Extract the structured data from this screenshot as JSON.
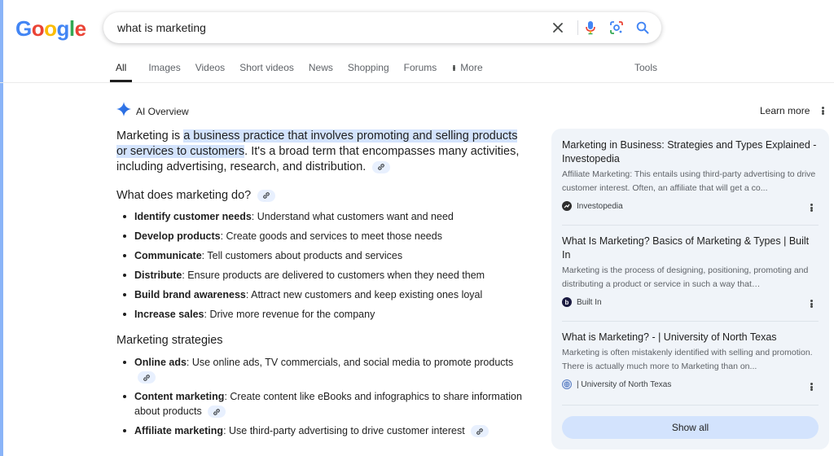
{
  "logo": {
    "letters": [
      "G",
      "o",
      "o",
      "g",
      "l",
      "e"
    ]
  },
  "search": {
    "query": "what is marketing"
  },
  "tabs": [
    {
      "label": "All",
      "active": true
    },
    {
      "label": "Images"
    },
    {
      "label": "Videos"
    },
    {
      "label": "Short videos"
    },
    {
      "label": "News"
    },
    {
      "label": "Shopping"
    },
    {
      "label": "Forums"
    },
    {
      "label": "More"
    }
  ],
  "tools_label": "Tools",
  "ai_overview": {
    "title": "AI Overview",
    "learn_more": "Learn more",
    "summary_prefix": "Marketing is ",
    "summary_highlight_1": "a business practice that involves promoting and selling products",
    "summary_highlight_2": "or services to customers",
    "summary_rest": ". It's a broad term that encompasses many activities, including advertising, research, and distribution.",
    "section1_heading": "What does marketing do?",
    "section1_items": [
      {
        "term": "Identify customer needs",
        "desc": ": Understand what customers want and need"
      },
      {
        "term": "Develop products",
        "desc": ": Create goods and services to meet those needs"
      },
      {
        "term": "Communicate",
        "desc": ": Tell customers about products and services"
      },
      {
        "term": "Distribute",
        "desc": ": Ensure products are delivered to customers when they need them"
      },
      {
        "term": "Build brand awareness",
        "desc": ": Attract new customers and keep existing ones loyal"
      },
      {
        "term": "Increase sales",
        "desc": ": Drive more revenue for the company"
      }
    ],
    "section2_heading": "Marketing strategies",
    "section2_items": [
      {
        "term": "Online ads",
        "desc": ": Use online ads, TV commercials, and social media to promote products"
      },
      {
        "term": "Content marketing",
        "desc": ": Create content like eBooks and infographics to share information about products"
      },
      {
        "term": "Affiliate marketing",
        "desc": ": Use third-party advertising to drive customer interest"
      }
    ]
  },
  "sources": [
    {
      "title": "Marketing in Business: Strategies and Types Explained - Investopedia",
      "snippet": "Affiliate Marketing: This entails using third-party advertising to drive customer interest. Often, an affiliate that will get a co...",
      "site": "Investopedia",
      "favicon_color": "#2d2d2d"
    },
    {
      "title": "What Is Marketing? Basics of Marketing & Types | Built In",
      "snippet": "Marketing is the process of designing, positioning, promoting and distributing a product or service in such a way that…",
      "site": "Built In",
      "favicon_color": "#1a1a40"
    },
    {
      "title": "What is Marketing? - | University of North Texas",
      "snippet": "Marketing is often mistakenly identified with selling and promotion. There is actually much more to Marketing than on...",
      "site": "| University of North Texas",
      "favicon_color": "#5b7fc4"
    }
  ],
  "show_all_label": "Show all",
  "colors": {
    "accent_blue": "#1a73e8",
    "chip_bg": "#d3e3fd",
    "panel_bg": "#f0f4f9"
  }
}
